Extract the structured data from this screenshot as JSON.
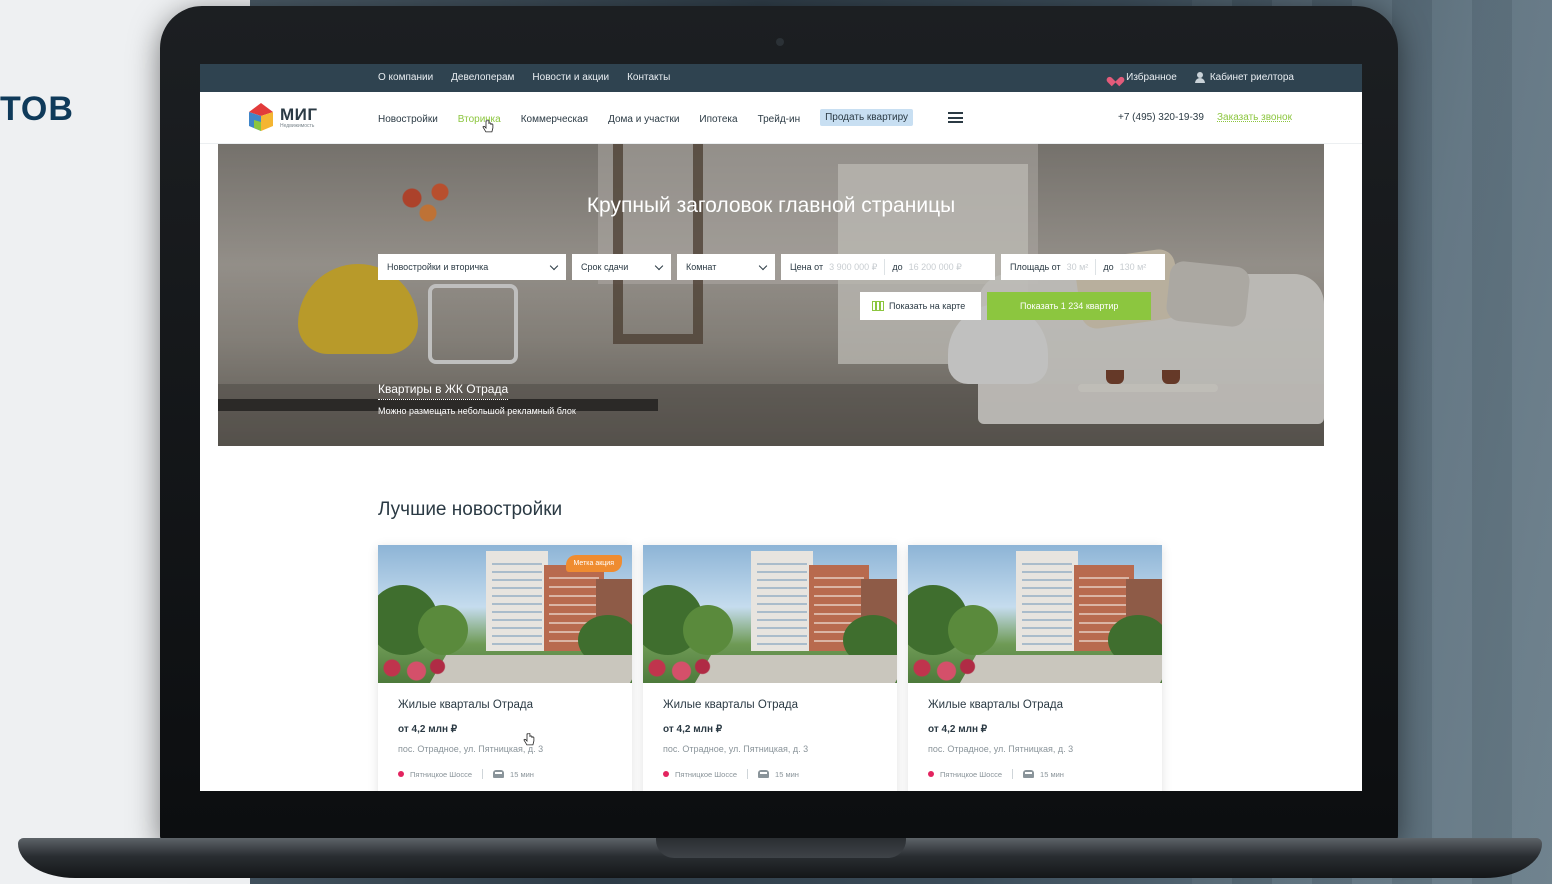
{
  "backdrop": {
    "side_word": "ТОВ"
  },
  "topbar": {
    "links": [
      "О компании",
      "Девелоперам",
      "Новости и акции",
      "Контакты"
    ],
    "favorites": "Избранное",
    "realtor_cabinet": "Кабинет риелтора"
  },
  "logo": {
    "name": "МИГ",
    "subtitle": "Недвижимость"
  },
  "nav": {
    "items": [
      "Новостройки",
      "Вторичка",
      "Коммерческая",
      "Дома и участки",
      "Ипотека",
      "Трейд-ин"
    ],
    "active": "Вторичка",
    "sell_button": "Продать квартиру"
  },
  "contacts": {
    "phone": "+7 (495) 320-19-39",
    "callback": "Заказать звонок"
  },
  "colors": {
    "accent_green": "#8cc63f",
    "topbar": "#2f4350",
    "promo_badge": "#ef8c30",
    "metro": "#e3245f"
  },
  "hero": {
    "title": "Крупный заголовок главной страницы",
    "filters": {
      "type_select": "Новостройки и вторичка",
      "deadline_select": "Срок сдачи",
      "rooms_select": "Комнат",
      "price_from_label": "Цена от",
      "price_from_placeholder": "3 900 000 ₽",
      "price_to_label": "до",
      "price_to_placeholder": "16 200 000 ₽",
      "area_from_label": "Площадь от",
      "area_from_placeholder": "30 м²",
      "area_to_label": "до",
      "area_to_placeholder": "130 м²"
    },
    "map_button": "Показать на карте",
    "show_button": "Показать 1 234 квартир",
    "promo_title": "Квартиры в ЖК Отрада",
    "promo_subtitle": "Можно размещать небольшой рекламный блок"
  },
  "listings": {
    "title": "Лучшие новостройки",
    "cards": [
      {
        "badge": "Метка акция",
        "name": "Жилые кварталы Отрада",
        "price": "от 4,2 млн ₽",
        "address": "пос. Отрадное, ул. Пятницкая, д. 3",
        "metro": "Пятницкое Шоссе",
        "drive_time": "15 мин"
      },
      {
        "badge": "",
        "name": "Жилые кварталы Отрада",
        "price": "от 4,2 млн ₽",
        "address": "пос. Отрадное, ул. Пятницкая, д. 3",
        "metro": "Пятницкое Шоссе",
        "drive_time": "15 мин"
      },
      {
        "badge": "",
        "name": "Жилые кварталы Отрада",
        "price": "от 4,2 млн ₽",
        "address": "пос. Отрадное, ул. Пятницкая, д. 3",
        "metro": "Пятницкое Шоссе",
        "drive_time": "15 мин"
      }
    ]
  }
}
